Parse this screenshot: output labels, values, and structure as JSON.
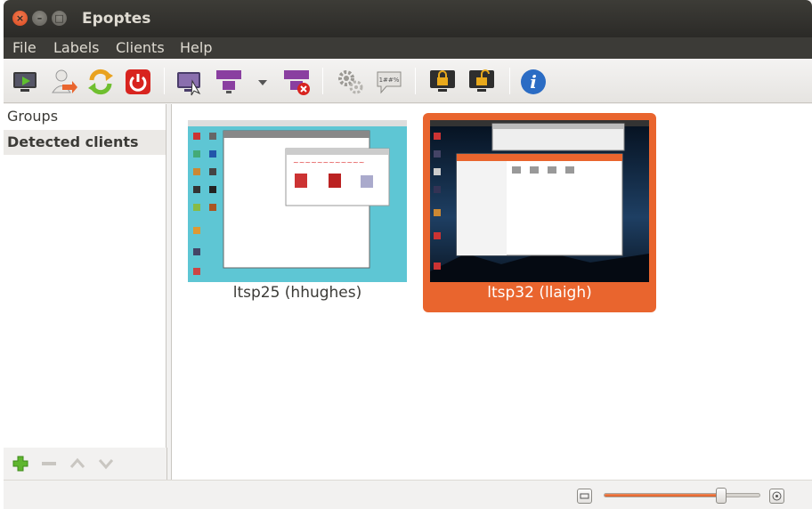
{
  "window": {
    "title": "Epoptes"
  },
  "menubar": {
    "items": [
      "File",
      "Labels",
      "Clients",
      "Help"
    ]
  },
  "toolbar": {
    "icons": [
      "monitor-broadcast-icon",
      "user-transfer-icon",
      "reboot-icon",
      "shutdown-icon",
      "screen-broadcast-icon",
      "multi-monitor-icon",
      "dropdown-arrow-icon",
      "stop-broadcast-icon",
      "execute-gears-icon",
      "send-message-icon",
      "lock-screen-icon",
      "unlock-screen-icon",
      "info-icon"
    ],
    "message_bubble_text": "1##%"
  },
  "sidebar": {
    "rows": [
      "Groups",
      "Detected clients"
    ],
    "selected": "Detected clients",
    "tools": [
      "add-group-icon",
      "remove-group-icon",
      "move-up-icon",
      "move-down-icon"
    ]
  },
  "clients": [
    {
      "label": "ltsp25 (hhughes)",
      "selected": false
    },
    {
      "label": "ltsp32 (llaigh)",
      "selected": true
    }
  ],
  "statusbar": {
    "zoom_level": 0.75
  },
  "colors": {
    "accent": "#e9652e",
    "titlebar": "#3c3b37",
    "selection": "#e9652e"
  }
}
